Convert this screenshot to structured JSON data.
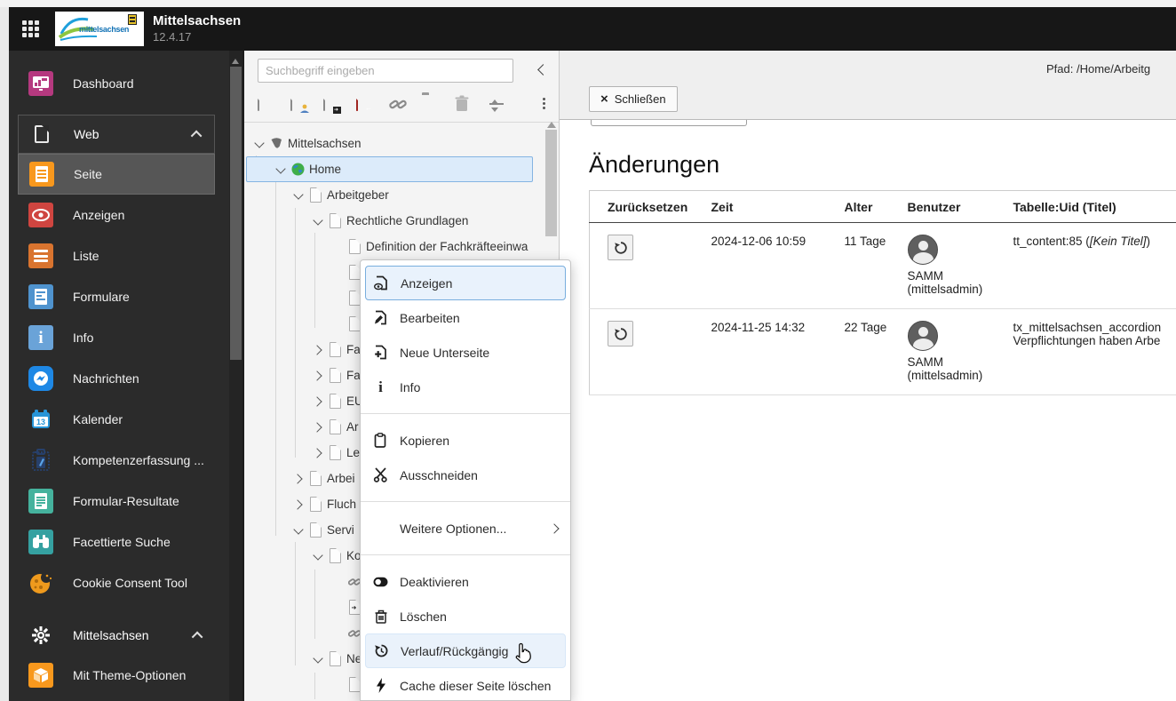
{
  "topbar": {
    "product": "Mittelsachsen",
    "version": "12.4.17",
    "logo_text": "mittelsachsen"
  },
  "module_menu": {
    "dashboard": "Dashboard",
    "web_group": "Web",
    "items": [
      {
        "label": "Seite"
      },
      {
        "label": "Anzeigen"
      },
      {
        "label": "Liste"
      },
      {
        "label": "Formulare"
      },
      {
        "label": "Info"
      },
      {
        "label": "Nachrichten"
      },
      {
        "label": "Kalender"
      },
      {
        "label": "Kompetenzerfassung ..."
      },
      {
        "label": "Formular-Resultate"
      },
      {
        "label": "Facettierte Suche"
      },
      {
        "label": "Cookie Consent Tool"
      }
    ],
    "mittelsachsen_group": "Mittelsachsen",
    "theme_item": "Mit Theme-Optionen"
  },
  "pagetree": {
    "search_placeholder": "Suchbegriff eingeben",
    "nodes": [
      {
        "label": "Mittelsachsen"
      },
      {
        "label": "Home"
      },
      {
        "label": "Arbeitgeber"
      },
      {
        "label": "Rechtliche Grundlagen"
      },
      {
        "label": "Definition der Fachkräfteeinwa"
      },
      {
        "label": ""
      },
      {
        "label": ""
      },
      {
        "label": ""
      },
      {
        "label": "Fa"
      },
      {
        "label": "Fa"
      },
      {
        "label": "EU"
      },
      {
        "label": "Ar"
      },
      {
        "label": "Le"
      },
      {
        "label": "Arbei"
      },
      {
        "label": "Fluch"
      },
      {
        "label": "Servi"
      },
      {
        "label": "Ko"
      },
      {
        "label": ""
      },
      {
        "label": ""
      },
      {
        "label": ""
      },
      {
        "label": "Ne"
      },
      {
        "label": ""
      }
    ]
  },
  "context_menu": {
    "items": [
      {
        "label": "Anzeigen"
      },
      {
        "label": "Bearbeiten"
      },
      {
        "label": "Neue Unterseite"
      },
      {
        "label": "Info"
      },
      {
        "label": "Kopieren"
      },
      {
        "label": "Ausschneiden"
      },
      {
        "label": "Weitere Optionen..."
      },
      {
        "label": "Deaktivieren"
      },
      {
        "label": "Löschen"
      },
      {
        "label": "Verlauf/Rückgängig"
      },
      {
        "label": "Cache dieser Seite löschen"
      }
    ]
  },
  "content": {
    "path": "Pfad: /Home/Arbeitg",
    "close_label": "Schließen",
    "heading": "Änderungen",
    "table": {
      "headers": [
        "Zurücksetzen",
        "Zeit",
        "Alter",
        "Benutzer",
        "Tabelle:Uid (Titel)"
      ],
      "rows": [
        {
          "time": "2024-12-06 10:59",
          "age": "11 Tage",
          "user": "SAMM",
          "user_login": "(mittelsadmin)",
          "record_prefix": "tt_content:85 (",
          "record_title": "[Kein Titel]",
          "record_suffix": ")"
        },
        {
          "time": "2024-11-25 14:32",
          "age": "22 Tage",
          "user": "SAMM",
          "user_login": "(mittelsadmin)",
          "record_line1": "tx_mittelsachsen_accordion",
          "record_line2": "Verpflichtungen haben Arbe"
        }
      ]
    }
  },
  "colors": {
    "topbar_bg": "#171717",
    "sidebar_bg": "#2b2b2b",
    "accent_orange": "#f8981d",
    "selected_blue_bg": "#dcebfa",
    "selected_blue_border": "#84b4e2",
    "menu_active_bg": "#e9f2fc",
    "menu_active_border": "#79aede"
  }
}
